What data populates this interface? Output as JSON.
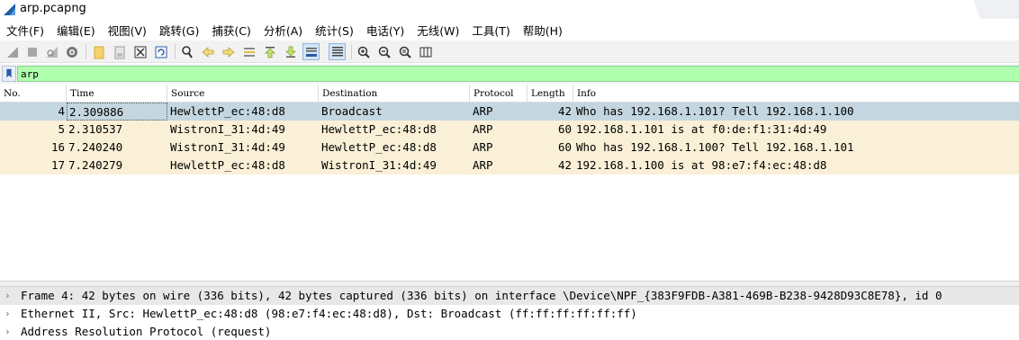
{
  "window": {
    "title": "arp.pcapng"
  },
  "menu": [
    "文件(F)",
    "编辑(E)",
    "视图(V)",
    "跳转(G)",
    "捕获(C)",
    "分析(A)",
    "统计(S)",
    "电话(Y)",
    "无线(W)",
    "工具(T)",
    "帮助(H)"
  ],
  "toolbar": {
    "icons": [
      "shark-fin-start-icon",
      "stop-square-icon",
      "restart-fin-icon",
      "capture-options-gear-icon",
      "open-folder-icon",
      "file-save-icon",
      "close-file-icon",
      "reload-icon",
      "search-magnifier-icon",
      "go-back-arrow-icon",
      "go-forward-arrow-icon",
      "go-to-packet-icon",
      "go-first-packet-icon",
      "go-last-packet-icon",
      "autoscroll-icon",
      "colorize-icon",
      "zoom-in-icon",
      "zoom-out-icon",
      "zoom-normal-icon",
      "resize-columns-icon"
    ],
    "selected_icons": [
      "autoscroll-icon",
      "colorize-icon"
    ]
  },
  "filter": {
    "value": "arp",
    "background": "#afffaf"
  },
  "packet_list": {
    "columns": [
      "No.",
      "Time",
      "Source",
      "Destination",
      "Protocol",
      "Length",
      "Info"
    ],
    "rows": [
      {
        "no": "4",
        "time": "2.309886",
        "source": "HewlettP_ec:48:d8",
        "destination": "Broadcast",
        "protocol": "ARP",
        "length": "42",
        "info": "Who has 192.168.1.101? Tell 192.168.1.100",
        "selected": true
      },
      {
        "no": "5",
        "time": "2.310537",
        "source": "WistronI_31:4d:49",
        "destination": "HewlettP_ec:48:d8",
        "protocol": "ARP",
        "length": "60",
        "info": "192.168.1.101 is at f0:de:f1:31:4d:49",
        "selected": false
      },
      {
        "no": "16",
        "time": "7.240240",
        "source": "WistronI_31:4d:49",
        "destination": "HewlettP_ec:48:d8",
        "protocol": "ARP",
        "length": "60",
        "info": "Who has 192.168.1.100? Tell 192.168.1.101",
        "selected": false
      },
      {
        "no": "17",
        "time": "7.240279",
        "source": "HewlettP_ec:48:d8",
        "destination": "WistronI_31:4d:49",
        "protocol": "ARP",
        "length": "42",
        "info": "192.168.1.100 is at 98:e7:f4:ec:48:d8",
        "selected": false
      }
    ],
    "colors": {
      "selected_row": "#c4d7e0",
      "arp_row": "#faf0d7"
    }
  },
  "details": [
    {
      "text": "Frame 4: 42 bytes on wire (336 bits), 42 bytes captured (336 bits) on interface \\Device\\NPF_{383F9FDB-A381-469B-B238-9428D93C8E78}, id 0",
      "expanded": false,
      "selected": true
    },
    {
      "text": "Ethernet II, Src: HewlettP_ec:48:d8 (98:e7:f4:ec:48:d8), Dst: Broadcast (ff:ff:ff:ff:ff:ff)",
      "expanded": false,
      "selected": false
    },
    {
      "text": "Address Resolution Protocol (request)",
      "expanded": false,
      "selected": false
    }
  ],
  "glyphs": {
    "collapsed_arrow": "›"
  }
}
